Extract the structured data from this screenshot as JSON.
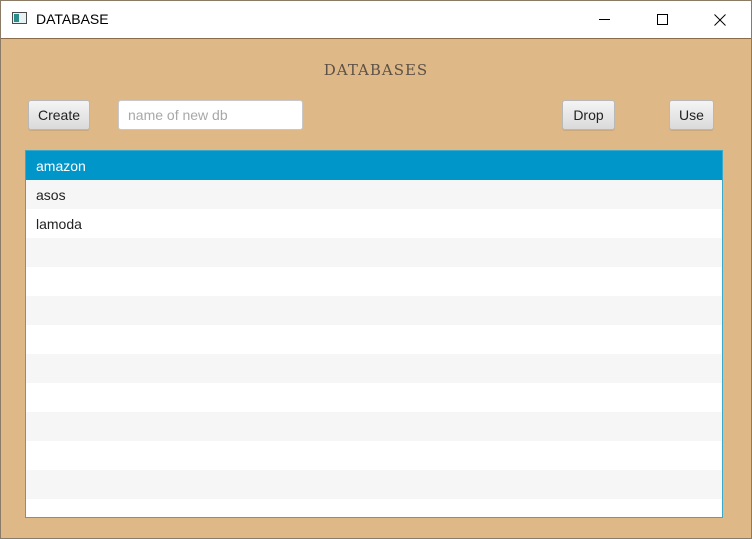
{
  "window": {
    "title": "DATABASE",
    "icon": "app-window-icon",
    "controls": [
      "minimize-icon",
      "maximize-icon",
      "close-icon"
    ]
  },
  "main": {
    "heading": "DATABASES",
    "create_label": "Create",
    "name_input": {
      "value": "",
      "placeholder": "name of new db"
    },
    "drop_label": "Drop",
    "use_label": "Use",
    "databases": [
      "amazon",
      "asos",
      "lamoda"
    ],
    "selected": "amazon"
  },
  "colors": {
    "background": "#deb887",
    "selection": "#0096c9",
    "list_border": "#3aa9c9"
  }
}
